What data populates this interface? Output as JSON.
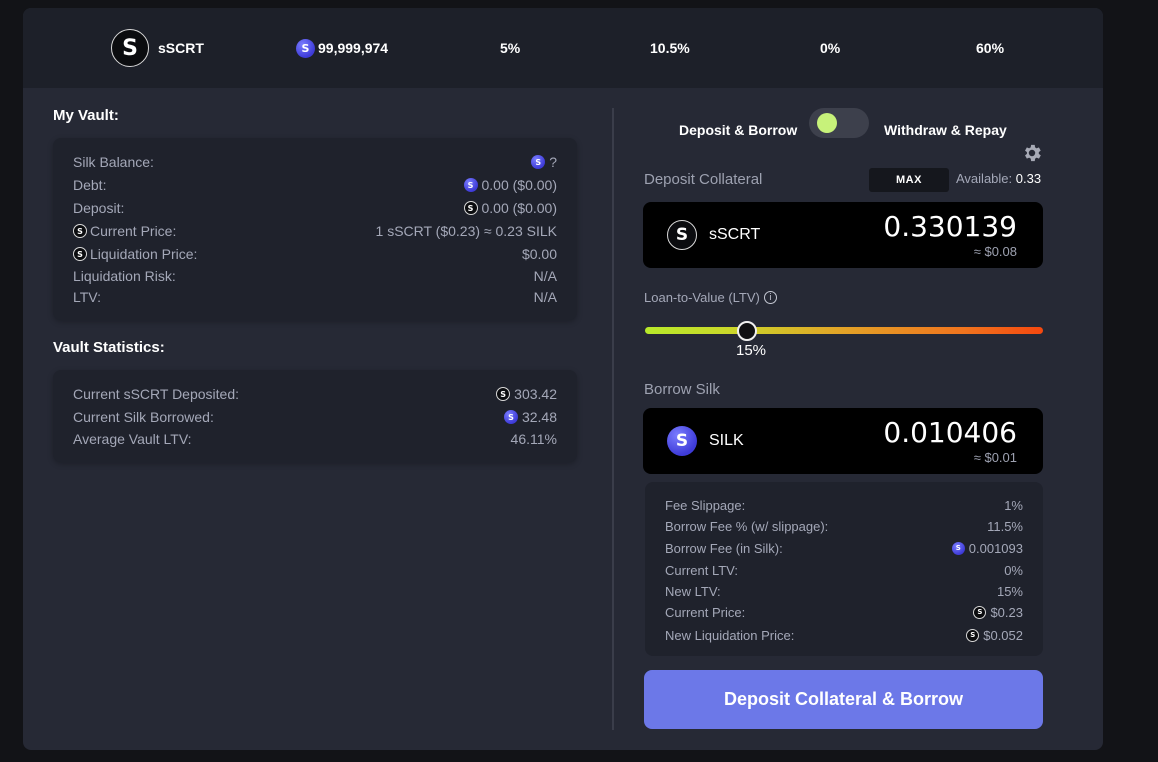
{
  "topbar": {
    "token_name": "sSCRT",
    "token_icon": "sscrt-coin-icon",
    "supply_icon": "silk-coin-icon",
    "supply": "99,999,974",
    "stat_1": "5%",
    "stat_2": "10.5%",
    "stat_3": "0%",
    "stat_4": "60%"
  },
  "my_vault": {
    "title": "My Vault:",
    "rows": [
      {
        "label": "Silk Balance:",
        "value": "?",
        "icon": "silk-coin-icon"
      },
      {
        "label": "Debt:",
        "value": "0.00 ($0.00)",
        "icon": "silk-coin-icon"
      },
      {
        "label": "Deposit:",
        "value": "0.00 ($0.00)",
        "icon": "sscrt-coin-icon"
      },
      {
        "label": "Current Price:",
        "value": "1 sSCRT ($0.23) ≈ 0.23 SILK",
        "label_icon": "sscrt-coin-icon"
      },
      {
        "label": "Liquidation Price:",
        "value": "$0.00",
        "label_icon": "sscrt-coin-icon"
      },
      {
        "label": "Liquidation Risk:",
        "value": "N/A"
      },
      {
        "label": "LTV:",
        "value": "N/A"
      }
    ]
  },
  "vault_stats": {
    "title": "Vault Statistics:",
    "rows": [
      {
        "label": "Current sSCRT Deposited:",
        "value": "303.42",
        "icon": "sscrt-coin-icon"
      },
      {
        "label": "Current Silk Borrowed:",
        "value": "32.48",
        "icon": "silk-coin-icon"
      },
      {
        "label": "Average Vault LTV:",
        "value": "46.11%"
      }
    ]
  },
  "mode": {
    "left_label": "Deposit & Borrow",
    "right_label": "Withdraw & Repay",
    "selected": "Deposit & Borrow",
    "toggle_color": "#c7f27a"
  },
  "settings_icon": "gear-icon",
  "deposit": {
    "title": "Deposit Collateral",
    "max_label": "MAX",
    "available_label": "Available:",
    "available_value": "0.33",
    "token": "sSCRT",
    "amount": "0.330139",
    "usd": "≈ $0.08"
  },
  "ltv": {
    "label": "Loan-to-Value (LTV)",
    "info_icon": "info-icon",
    "value_label": "15%",
    "value": 0.15
  },
  "borrow": {
    "title": "Borrow Silk",
    "token": "SILK",
    "amount": "0.010406",
    "usd": "≈ $0.01"
  },
  "fees": [
    {
      "label": "Fee Slippage:",
      "value": "1%"
    },
    {
      "label": "Borrow Fee % (w/ slippage):",
      "value": "11.5%"
    },
    {
      "label": "Borrow Fee (in Silk):",
      "value": "0.001093",
      "icon": "silk-coin-icon"
    },
    {
      "label": "Current LTV:",
      "value": "0%"
    },
    {
      "label": "New LTV:",
      "value": "15%"
    },
    {
      "label": "Current Price:",
      "value": "$0.23",
      "icon": "sscrt-coin-icon"
    },
    {
      "label": "New Liquidation Price:",
      "value": "$0.052",
      "icon": "sscrt-coin-icon"
    }
  ],
  "cta_label": "Deposit Collateral & Borrow",
  "colors": {
    "accent": "#6c78e8",
    "panel": "#262935",
    "card": "#1f222c",
    "input": "#000000"
  }
}
